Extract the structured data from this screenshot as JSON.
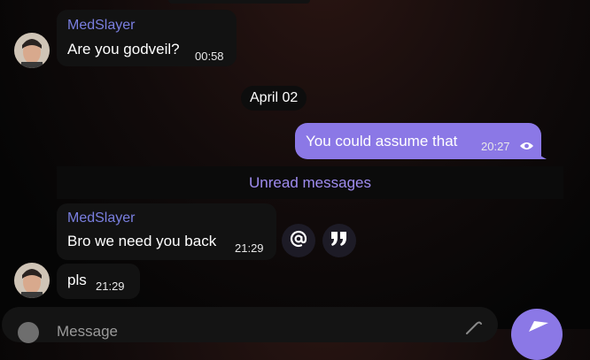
{
  "messages": [
    {
      "sender": "MedSlayer",
      "text": "Are you godveil?",
      "time": "00:58"
    },
    {
      "date": "April 02"
    },
    {
      "text": "You could assume that",
      "time": "20:27"
    },
    {
      "unread_label": "Unread messages"
    },
    {
      "sender": "MedSlayer",
      "text": "Bro we need you back",
      "time": "21:29"
    },
    {
      "text": "pls",
      "time": "21:29"
    }
  ],
  "icons": {
    "avatar": "avatar-photo",
    "read": "eye-icon",
    "mention": "at-icon",
    "quote": "quote-icon",
    "send": "send-icon",
    "attach": "paperclip-icon"
  },
  "colors": {
    "accent": "#8b78e6",
    "sender": "#7a7fe0",
    "unread": "#9f8cf0"
  },
  "composer": {
    "placeholder": "Message"
  }
}
